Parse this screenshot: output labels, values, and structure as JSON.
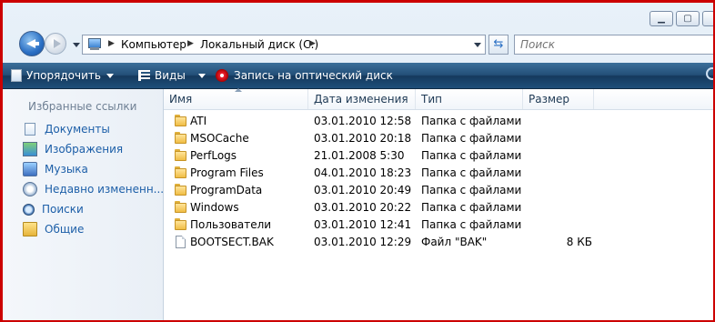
{
  "address": {
    "crumbs": [
      "Компьютер",
      "Локальный диск (C:)"
    ]
  },
  "search": {
    "placeholder": "Поиск"
  },
  "toolbar": {
    "organize": "Упорядочить",
    "views": "Виды",
    "burn": "Запись на оптический диск"
  },
  "nav_pane": {
    "title": "Избранные ссылки",
    "items": [
      {
        "label": "Документы",
        "icon": "documents-icon"
      },
      {
        "label": "Изображения",
        "icon": "pictures-icon"
      },
      {
        "label": "Музыка",
        "icon": "music-icon"
      },
      {
        "label": "Недавно измененн...",
        "icon": "recent-icon"
      },
      {
        "label": "Поиски",
        "icon": "searches-icon"
      },
      {
        "label": "Общие",
        "icon": "public-icon"
      }
    ]
  },
  "columns": {
    "name": "Имя",
    "date": "Дата изменения",
    "type": "Тип",
    "size": "Размер"
  },
  "files": [
    {
      "name": "ATI",
      "date": "03.01.2010 12:58",
      "type": "Папка с файлами",
      "size": "",
      "kind": "folder"
    },
    {
      "name": "MSOCache",
      "date": "03.01.2010 20:18",
      "type": "Папка с файлами",
      "size": "",
      "kind": "folder"
    },
    {
      "name": "PerfLogs",
      "date": "21.01.2008 5:30",
      "type": "Папка с файлами",
      "size": "",
      "kind": "folder"
    },
    {
      "name": "Program Files",
      "date": "04.01.2010 18:23",
      "type": "Папка с файлами",
      "size": "",
      "kind": "folder"
    },
    {
      "name": "ProgramData",
      "date": "03.01.2010 20:49",
      "type": "Папка с файлами",
      "size": "",
      "kind": "folder"
    },
    {
      "name": "Windows",
      "date": "03.01.2010 20:22",
      "type": "Папка с файлами",
      "size": "",
      "kind": "folder"
    },
    {
      "name": "Пользователи",
      "date": "03.01.2010 12:41",
      "type": "Папка с файлами",
      "size": "",
      "kind": "folder"
    },
    {
      "name": "BOOTSECT.BAK",
      "date": "03.01.2010 12:29",
      "type": "Файл \"BAK\"",
      "size": "8 КБ",
      "kind": "file"
    }
  ]
}
